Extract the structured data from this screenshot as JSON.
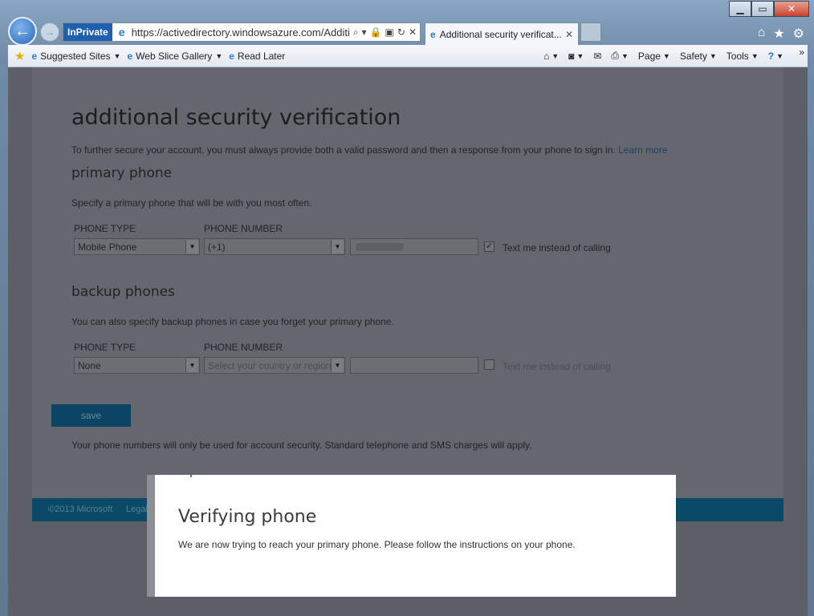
{
  "browser": {
    "inprivate": "InPrivate",
    "url": "https://activedirectory.windowsazure.com/Additior",
    "tab_title": "Additional security verificat...",
    "favorites": [
      {
        "label": "Suggested Sites"
      },
      {
        "label": "Web Slice Gallery"
      },
      {
        "label": "Read Later"
      }
    ],
    "commands": {
      "page": "Page",
      "safety": "Safety",
      "tools": "Tools"
    }
  },
  "page": {
    "title": "additional security verification",
    "intro": "To further secure your account, you must always provide both a valid password and then a response from your phone to sign in.",
    "learn_more": "Learn more",
    "primary": {
      "heading": "primary phone",
      "desc": "Specify a primary phone that will be with you most often.",
      "type_label": "PHONE TYPE",
      "number_label": "PHONE NUMBER",
      "type_value": "Mobile Phone",
      "country_value": "(+1)",
      "text_me": "Text me instead of calling",
      "text_me_checked": true
    },
    "backup": {
      "heading": "backup phones",
      "desc": "You can also specify backup phones in case you forget your primary phone.",
      "type_label": "PHONE TYPE",
      "number_label": "PHONE NUMBER",
      "type_value": "None",
      "country_placeholder": "Select your country or region",
      "text_me": "Text me instead of calling",
      "text_me_checked": false
    },
    "save": "save",
    "disclaimer": "Your phone numbers will only be used for account security. Standard telephone and SMS charges will apply.",
    "footer": {
      "copyright": "©2013 Microsoft",
      "legal": "Legal"
    }
  },
  "modal": {
    "title": "Verifying phone",
    "message": "We are now trying to reach your primary phone. Please follow the instructions on your phone."
  }
}
